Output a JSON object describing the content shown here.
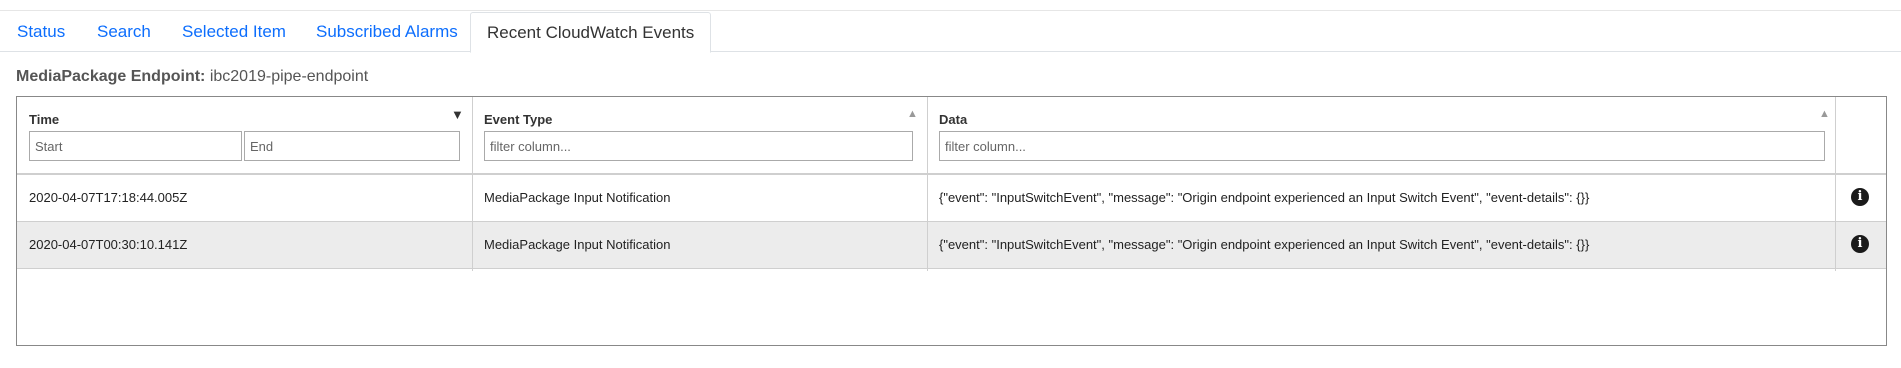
{
  "tabs": [
    {
      "label": "Status"
    },
    {
      "label": "Search"
    },
    {
      "label": "Selected Item"
    },
    {
      "label": "Subscribed Alarms"
    },
    {
      "label": "Recent CloudWatch Events"
    }
  ],
  "heading": {
    "label": "MediaPackage Endpoint:",
    "value": "ibc2019-pipe-endpoint"
  },
  "table": {
    "columns": [
      {
        "title": "Time",
        "sort": "descending"
      },
      {
        "title": "Event Type",
        "sort": "ascending"
      },
      {
        "title": "Data",
        "sort": "ascending"
      }
    ],
    "filters": {
      "start_placeholder": "Start",
      "end_placeholder": "End",
      "event_type_placeholder": "filter column...",
      "data_placeholder": "filter column..."
    },
    "rows": [
      {
        "time": "2020-04-07T17:18:44.005Z",
        "event_type": "MediaPackage Input Notification",
        "data": "{\"event\": \"InputSwitchEvent\", \"message\": \"Origin endpoint experienced an Input Switch Event\", \"event-details\": {}}"
      },
      {
        "time": "2020-04-07T00:30:10.141Z",
        "event_type": "MediaPackage Input Notification",
        "data": "{\"event\": \"InputSwitchEvent\", \"message\": \"Origin endpoint experienced an Input Switch Event\", \"event-details\": {}}"
      }
    ]
  },
  "icons": {
    "info": "info-circle-icon",
    "sort_desc": "caret-down-icon",
    "sort_asc": "caret-up-icon"
  }
}
